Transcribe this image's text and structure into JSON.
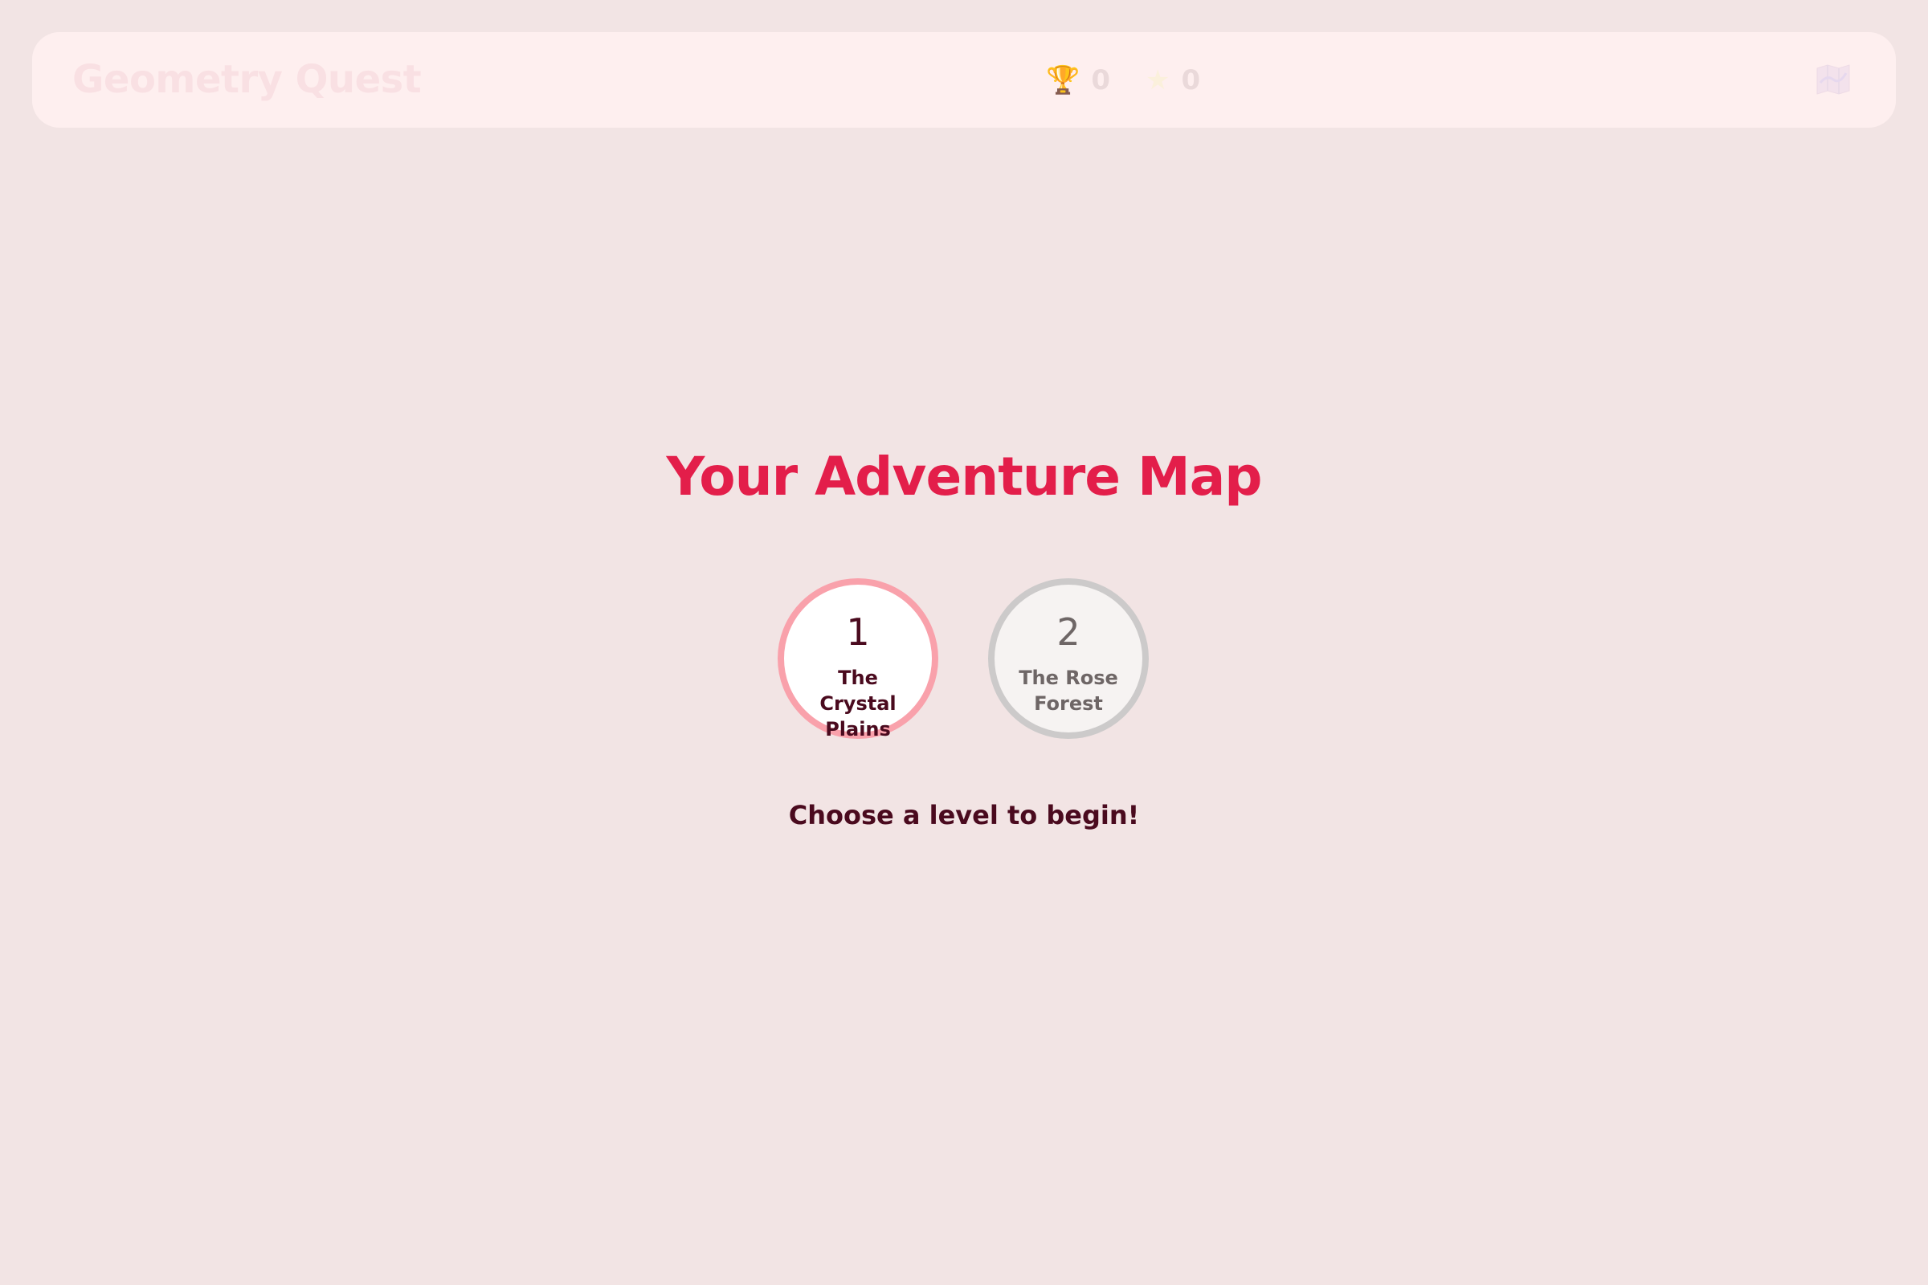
{
  "header": {
    "title": "Geometry Quest",
    "stats": [
      {
        "icon": "trophy-icon",
        "glyph": "🏆",
        "value": "0"
      },
      {
        "icon": "star-icon",
        "glyph": "★",
        "value": "0"
      }
    ],
    "map_icon": "map-icon"
  },
  "main": {
    "heading": "Your Adventure Map",
    "levels": [
      {
        "number": "1",
        "name": "The Crystal Plains",
        "state": "unlocked"
      },
      {
        "number": "2",
        "name": "The Rose Forest",
        "state": "locked"
      }
    ],
    "hint": "Choose a level to begin!"
  },
  "colors": {
    "background": "#f2e4e4",
    "accent": "#e31e4a",
    "text_dark": "#4a0a1e",
    "unlocked_ring": "#f9a1ab",
    "locked_ring": "#cccaca"
  }
}
